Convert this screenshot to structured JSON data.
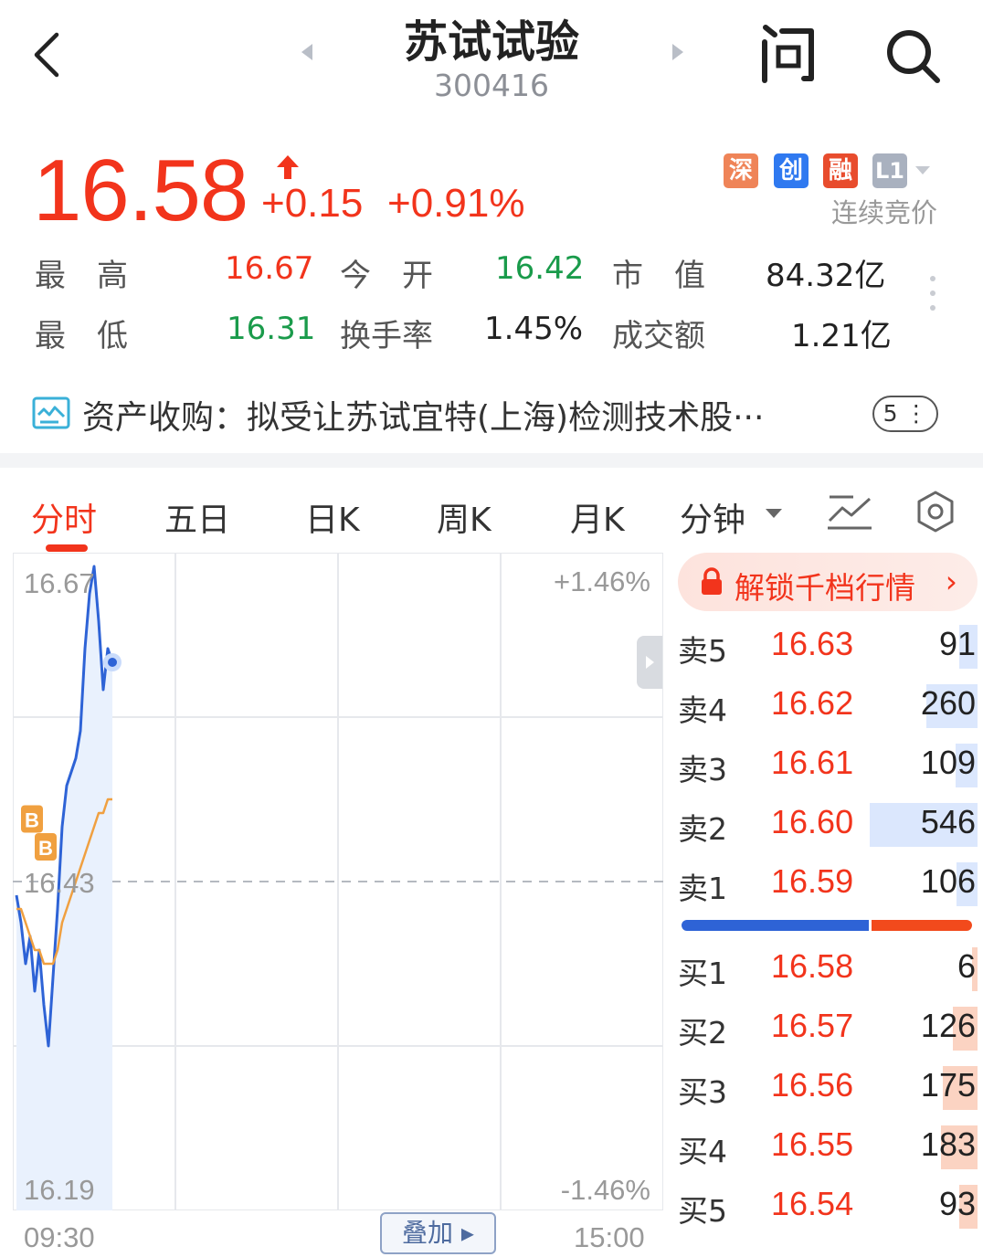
{
  "header": {
    "stock_name": "苏试试验",
    "stock_code": "300416",
    "ask_label": "问"
  },
  "quote": {
    "price": "16.58",
    "change": "+0.15",
    "change_pct": "+0.91%",
    "badges": [
      "深",
      "创",
      "融",
      "L1"
    ],
    "auction_status": "连续竞价",
    "colors": {
      "up": "#f2341c",
      "down": "#1a9b4b",
      "accent_blue": "#2f79f0"
    }
  },
  "stats": {
    "high_label": "最　高",
    "high": "16.67",
    "open_label": "今　开",
    "open": "16.42",
    "mktcap_label": "市　值",
    "mktcap": "84.32亿",
    "low_label": "最　低",
    "low": "16.31",
    "turnover_label": "换手率",
    "turnover": "1.45%",
    "amount_label": "成交额",
    "amount": "1.21亿"
  },
  "news": {
    "text": "资产收购：拟受让苏试宜特(上海)检测技术股···",
    "count": "5"
  },
  "tabs": [
    "分时",
    "五日",
    "日K",
    "周K",
    "月K",
    "分钟"
  ],
  "active_tab": "分时",
  "chart": {
    "y_max_label": "16.67",
    "y_mid_label": "16.43",
    "y_min_label": "16.19",
    "pct_max_label": "+1.46%",
    "pct_min_label": "-1.46%",
    "time_start": "09:30",
    "time_end": "15:00",
    "overlay_label": "叠加",
    "marker_labels": [
      "B",
      "B"
    ]
  },
  "chart_data": {
    "type": "line",
    "ylim": [
      16.19,
      16.67
    ],
    "reference_price": 16.43,
    "x_range": [
      "09:30",
      "15:00"
    ],
    "series": [
      {
        "color": "#2e63d6",
        "values": [
          16.42,
          16.4,
          16.37,
          16.39,
          16.35,
          16.38,
          16.34,
          16.31,
          16.36,
          16.41,
          16.47,
          16.5,
          16.51,
          16.52,
          16.54,
          16.6,
          16.64,
          16.66,
          16.62,
          16.57,
          16.6,
          16.59
        ]
      },
      {
        "color": "#f0a040",
        "values": [
          16.41,
          16.41,
          16.4,
          16.39,
          16.38,
          16.38,
          16.37,
          16.37,
          16.37,
          16.38,
          16.4,
          16.41,
          16.42,
          16.43,
          16.44,
          16.45,
          16.46,
          16.47,
          16.48,
          16.48,
          16.49,
          16.49
        ]
      }
    ]
  },
  "orderbook": {
    "unlock_label": "解锁千档行情",
    "sell": [
      {
        "label": "卖5",
        "price": "16.63",
        "volume": "91",
        "ratio": 0.166
      },
      {
        "label": "卖4",
        "price": "16.62",
        "volume": "260",
        "ratio": 0.476
      },
      {
        "label": "卖3",
        "price": "16.61",
        "volume": "109",
        "ratio": 0.2
      },
      {
        "label": "卖2",
        "price": "16.60",
        "volume": "546",
        "ratio": 1.0
      },
      {
        "label": "卖1",
        "price": "16.59",
        "volume": "106",
        "ratio": 0.194
      }
    ],
    "buy": [
      {
        "label": "买1",
        "price": "16.58",
        "volume": "6",
        "ratio": 0.011
      },
      {
        "label": "买2",
        "price": "16.57",
        "volume": "126",
        "ratio": 0.231
      },
      {
        "label": "买3",
        "price": "16.56",
        "volume": "175",
        "ratio": 0.32
      },
      {
        "label": "买4",
        "price": "16.55",
        "volume": "183",
        "ratio": 0.335
      },
      {
        "label": "买5",
        "price": "16.54",
        "volume": "93",
        "ratio": 0.17
      }
    ],
    "buy_sell_ratio": 0.65
  }
}
